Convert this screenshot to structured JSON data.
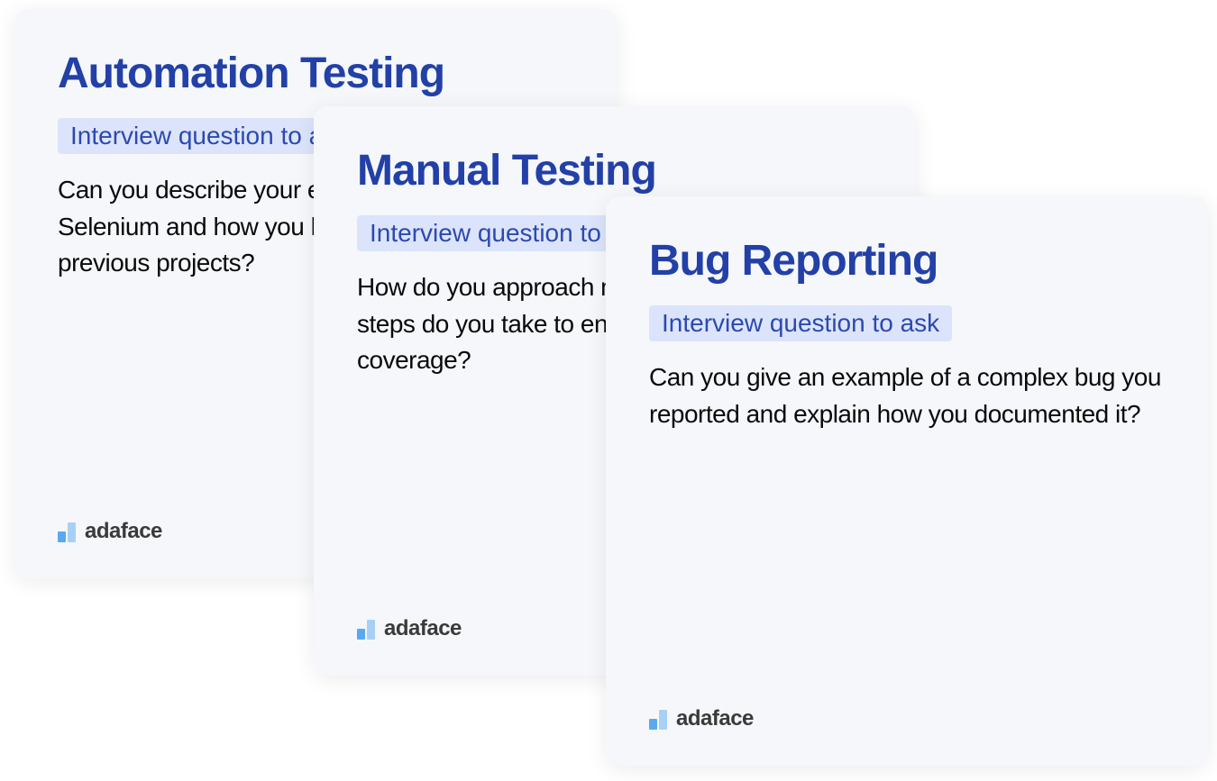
{
  "cards": [
    {
      "title": "Automation Testing",
      "subtitle": "Interview question to ask",
      "question": "Can you describe your experience with Selenium and how you have used it in your previous projects?"
    },
    {
      "title": "Manual Testing",
      "subtitle": "Interview question to ask",
      "question": "How do you approach manual testing, and what steps do you take to ensure comprehensive test coverage?"
    },
    {
      "title": "Bug Reporting",
      "subtitle": "Interview question to ask",
      "question": "Can you give an example of a complex bug you reported and explain how you documented it?"
    }
  ],
  "brand": {
    "name": "adaface"
  }
}
